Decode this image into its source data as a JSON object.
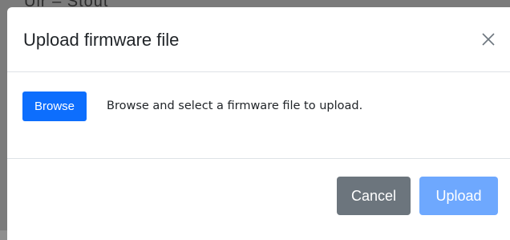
{
  "background": {
    "partial_text": "Uir – Stout"
  },
  "modal": {
    "title": "Upload firmware file",
    "close_icon": "close-icon",
    "body": {
      "browse_label": "Browse",
      "description": "Browse and select a firmware file to upload."
    },
    "footer": {
      "cancel_label": "Cancel",
      "upload_label": "Upload",
      "upload_disabled": true
    }
  },
  "colors": {
    "primary": "#0d6efd",
    "primary_disabled": "#6ea8fe",
    "secondary": "#6c757d",
    "divider": "#dee2e6"
  }
}
